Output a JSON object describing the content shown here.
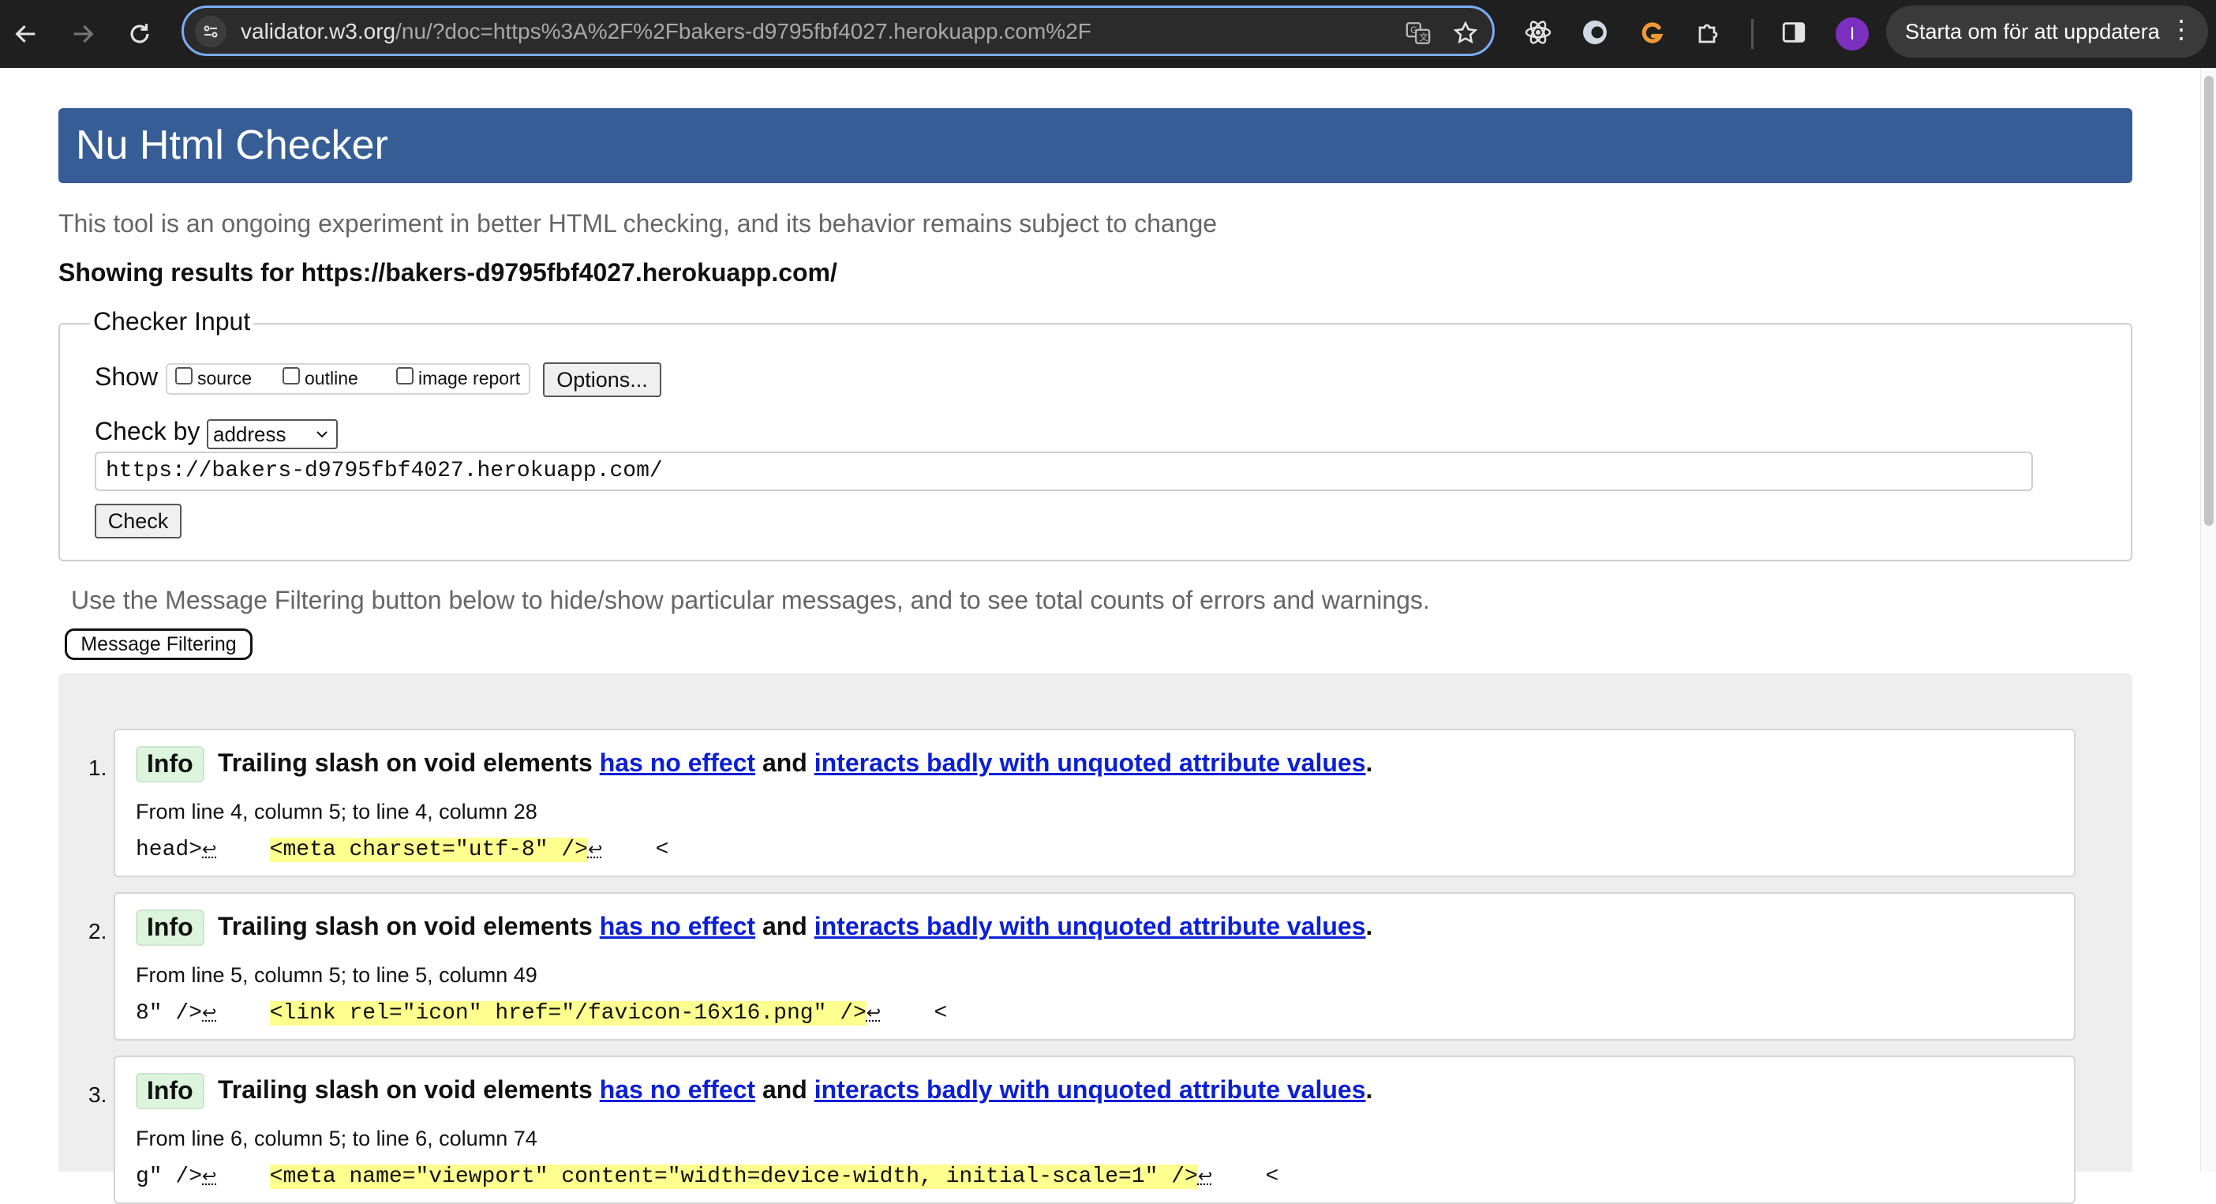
{
  "browser": {
    "url_host": "validator.w3.org",
    "url_path": "/nu/?doc=https%3A%2F%2Fbakers-d9795fbf4027.herokuapp.com%2F",
    "avatar_letter": "I",
    "update_label": "Starta om för att uppdatera",
    "icons": [
      "back-arrow-icon",
      "forward-arrow-icon",
      "reload-icon",
      "site-info-icon",
      "translate-icon",
      "star-icon",
      "react-devtools-icon",
      "extension-icon",
      "grammarly-icon",
      "puzzle-icon",
      "side-panel-icon",
      "more-vert-icon"
    ]
  },
  "page": {
    "title": "Nu Html Checker",
    "tagline": "This tool is an ongoing experiment in better HTML checking, and its behavior remains subject to change",
    "showing": "Showing results for https://bakers-d9795fbf4027.herokuapp.com/",
    "checker": {
      "legend": "Checker Input",
      "show_label": "Show",
      "options": [
        "source",
        "outline",
        "image report"
      ],
      "options_button": "Options...",
      "check_by_label": "Check by",
      "check_by_value": "address",
      "url_value": "https://bakers-d9795fbf4027.herokuapp.com/",
      "check_button": "Check"
    },
    "filter_note": "Use the Message Filtering button below to hide/show particular messages, and to see total counts of errors and warnings.",
    "filter_button": "Message Filtering"
  },
  "messages": [
    {
      "num": "1.",
      "type": "Info",
      "text_a": "Trailing slash on void elements ",
      "link1": "has no effect",
      "text_b": " and ",
      "link2": "interacts badly with unquoted attribute values",
      "text_c": ".",
      "location": "From line 4, column 5; to line 4, column 28",
      "code_pre": "head>",
      "code_mid": "    ",
      "code_hl": "<meta charset=\"utf-8\" />",
      "code_post": "    <",
      "lf": "↩"
    },
    {
      "num": "2.",
      "type": "Info",
      "text_a": "Trailing slash on void elements ",
      "link1": "has no effect",
      "text_b": " and ",
      "link2": "interacts badly with unquoted attribute values",
      "text_c": ".",
      "location": "From line 5, column 5; to line 5, column 49",
      "code_pre": "8\" />",
      "code_mid": "    ",
      "code_hl": "<link rel=\"icon\" href=\"/favicon-16x16.png\" />",
      "code_post": "    <",
      "lf": "↩"
    },
    {
      "num": "3.",
      "type": "Info",
      "text_a": "Trailing slash on void elements ",
      "link1": "has no effect",
      "text_b": " and ",
      "link2": "interacts badly with unquoted attribute values",
      "text_c": ".",
      "location": "From line 6, column 5; to line 6, column 74",
      "code_pre": "g\" />",
      "code_mid": "    ",
      "code_hl": "<meta name=\"viewport\" content=\"width=device-width, initial-scale=1\" />",
      "code_post": "    <",
      "lf": "↩"
    }
  ]
}
